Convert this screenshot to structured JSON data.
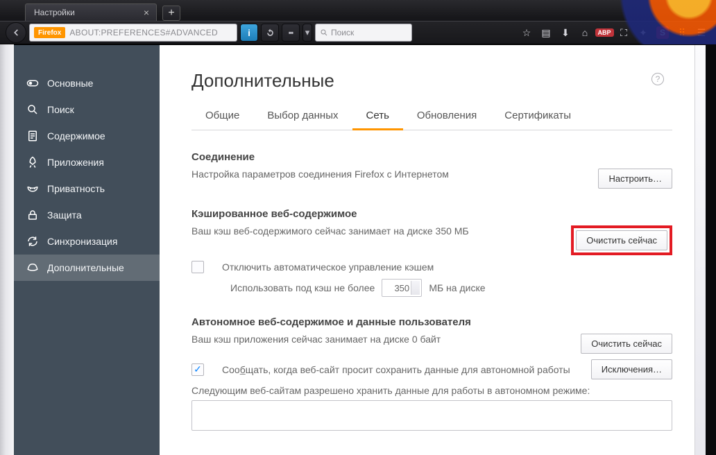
{
  "tab": {
    "title": "Настройки"
  },
  "url": {
    "brand": "Firefox",
    "path": "ABOUT:PREFERENCES#ADVANCED"
  },
  "search": {
    "placeholder": "Поиск"
  },
  "chrome_badges": {
    "abp": "ABP",
    "s": "S"
  },
  "sidebar": {
    "items": [
      {
        "label": "Основные"
      },
      {
        "label": "Поиск"
      },
      {
        "label": "Содержимое"
      },
      {
        "label": "Приложения"
      },
      {
        "label": "Приватность"
      },
      {
        "label": "Защита"
      },
      {
        "label": "Синхронизация"
      },
      {
        "label": "Дополнительные"
      }
    ]
  },
  "main": {
    "heading": "Дополнительные",
    "tabs": [
      "Общие",
      "Выбор данных",
      "Сеть",
      "Обновления",
      "Сертификаты"
    ],
    "connection": {
      "title": "Соединение",
      "desc": "Настройка параметров соединения Firefox с Интернетом",
      "btn": "Настроить…"
    },
    "cache": {
      "title": "Кэшированное веб-содержимое",
      "desc": "Ваш кэш веб-содержимого сейчас занимает на диске 350 МБ",
      "btn": "Очистить сейчас",
      "check_label": "Отключить автоматическое управление кэшем",
      "limit_prefix": "Использовать под кэш не более",
      "limit_value": "350",
      "limit_suffix": "МБ на диске"
    },
    "offline": {
      "title": "Автономное веб-содержимое и данные пользователя",
      "desc": "Ваш кэш приложения сейчас занимает на диске 0 байт",
      "btn": "Очистить сейчас",
      "notify_prefix": "Соо",
      "notify_u": "б",
      "notify_rest": "щать, когда веб-сайт просит сохранить данные для автономной работы",
      "exceptions": "Исключения…",
      "list_label": "Следующим веб-сайтам разрешено хранить данные для работы в автономном режиме:"
    }
  }
}
